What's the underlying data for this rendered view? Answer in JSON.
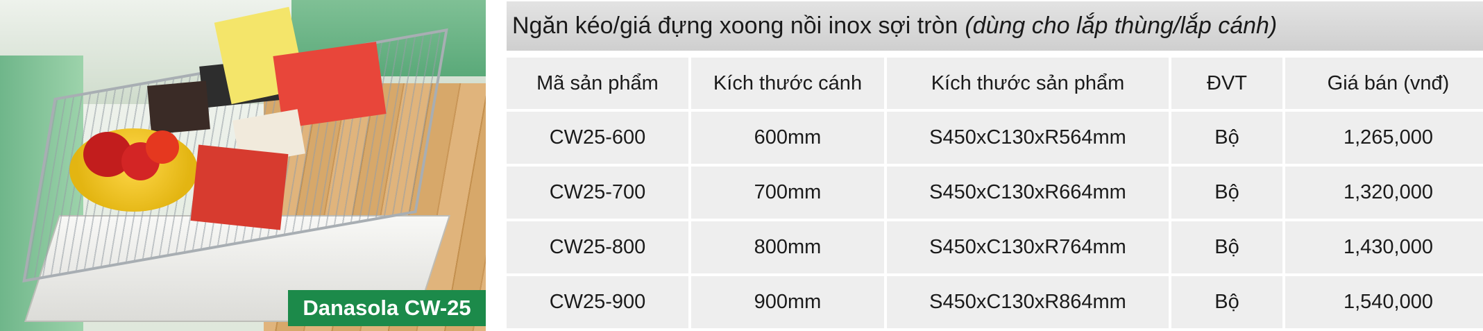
{
  "product_photo": {
    "brand_label": "Danasola CW-25"
  },
  "title": {
    "main": "Ngăn kéo/giá đựng xoong nồi inox sợi tròn",
    "note": "(dùng cho lắp thùng/lắp cánh)"
  },
  "table": {
    "headers": [
      "Mã sản phẩm",
      "Kích thước cánh",
      "Kích thước sản phẩm",
      "ĐVT",
      "Giá bán (vnđ)"
    ],
    "rows": [
      [
        "CW25-600",
        "600mm",
        "S450xC130xR564mm",
        "Bộ",
        "1,265,000"
      ],
      [
        "CW25-700",
        "700mm",
        "S450xC130xR664mm",
        "Bộ",
        "1,320,000"
      ],
      [
        "CW25-800",
        "800mm",
        "S450xC130xR764mm",
        "Bộ",
        "1,430,000"
      ],
      [
        "CW25-900",
        "900mm",
        "S450xC130xR864mm",
        "Bộ",
        "1,540,000"
      ]
    ]
  },
  "colors": {
    "brand_badge": "#1c8a4a",
    "title_bar": "#d9d9d9",
    "cell_bg": "#eeeeee"
  }
}
